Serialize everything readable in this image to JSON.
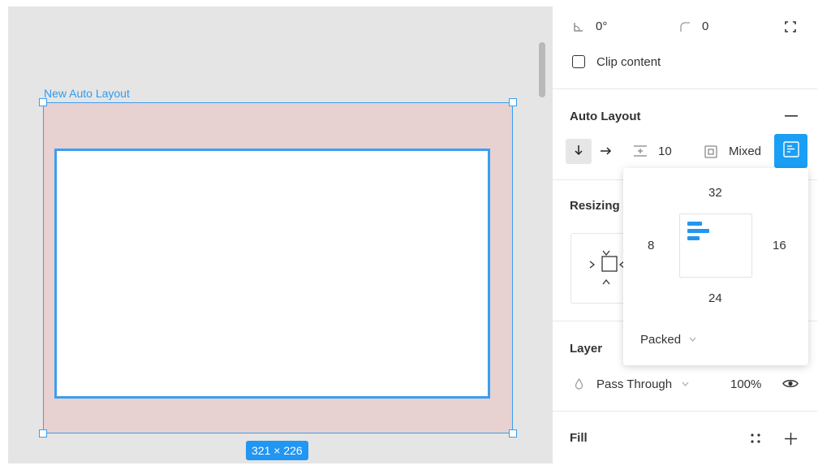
{
  "canvas": {
    "frame_label": "New Auto Layout",
    "dimensions": "321 × 226",
    "frame_fill": "#e7d1d1",
    "selection_color": "#3a9ff0"
  },
  "panel": {
    "transform": {
      "rotation": "0°",
      "corner_radius": "0",
      "rotation_icon": "angle-icon",
      "radius_icon": "corner-radius-icon",
      "independent_corners_icon": "expand-corners-icon"
    },
    "clip_content_label": "Clip content",
    "auto_layout": {
      "title": "Auto Layout",
      "spacing": "10",
      "padding_mode": "Mixed",
      "accent": "#1b9ff5"
    },
    "resizing": {
      "title": "Resizing"
    },
    "layer": {
      "title": "Layer",
      "blend": "Pass Through",
      "opacity": "100%"
    },
    "fill": {
      "title": "Fill"
    }
  },
  "popover": {
    "padding_top": "32",
    "padding_left": "8",
    "padding_right": "16",
    "padding_bottom": "24",
    "distribution": "Packed"
  }
}
